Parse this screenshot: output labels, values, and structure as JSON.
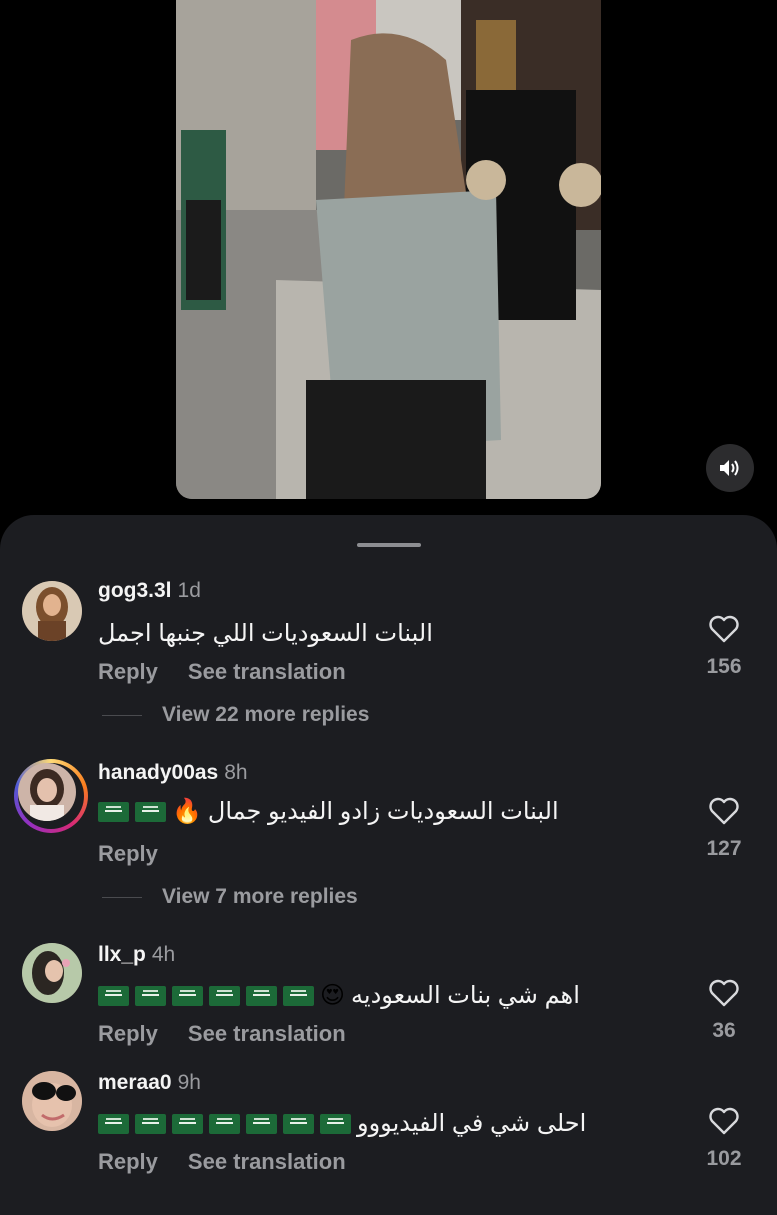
{
  "icons": {
    "mute": "speaker-icon",
    "like": "heart-outline-icon"
  },
  "colors": {
    "sheet_bg": "#1c1d21",
    "muted_text": "#9a9b9f",
    "flag_green": "#1c6a38"
  },
  "comments": [
    {
      "username": "gog3.3l",
      "time": "1d",
      "text": "البنات السعوديات اللي جنبها اجمل",
      "reply": "Reply",
      "see_translation": "See translation",
      "likes": "156",
      "more_replies": "View 22 more replies"
    },
    {
      "username": "hanady00as",
      "time": "8h",
      "text": "البنات السعوديات زادو الفيديو جمال",
      "emoji": "🔥",
      "flag_count": 2,
      "reply": "Reply",
      "likes": "127",
      "more_replies": "View 7 more replies"
    },
    {
      "username": "llx_p",
      "time": "4h",
      "text": "اهم شي بنات السعوديه",
      "emoji": "😍",
      "flag_count": 6,
      "reply": "Reply",
      "see_translation": "See translation",
      "likes": "36"
    },
    {
      "username": "meraa0",
      "time": "9h",
      "text": "احلى شي في الفيديووو",
      "flag_count": 7,
      "reply": "Reply",
      "see_translation": "See translation",
      "likes": "102"
    }
  ]
}
